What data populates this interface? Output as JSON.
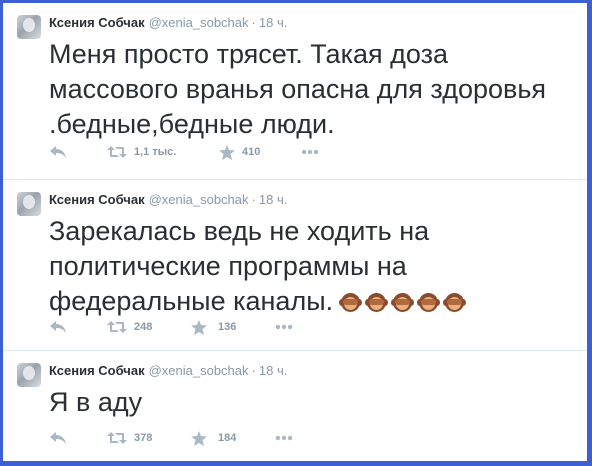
{
  "tweets": [
    {
      "name": "Ксения Собчак",
      "handle": "@xenia_sobchak",
      "separator": "·",
      "time": "18 ч.",
      "lines": [
        "Меня просто трясет. Такая доза",
        "массового вранья опасна для здоровья",
        ".бедные,бедные люди."
      ],
      "retweets": "1,1 тыс.",
      "favorites": "410"
    },
    {
      "name": "Ксения Собчак",
      "handle": "@xenia_sobchak",
      "separator": "·",
      "time": "18 ч.",
      "lines": [
        "Зарекалась ведь не ходить на",
        "политические программы на",
        "федеральные каналы."
      ],
      "emoji": "see-no-evil-monkey x5",
      "retweets": "248",
      "favorites": "136"
    },
    {
      "name": "Ксения Собчак",
      "handle": "@xenia_sobchak",
      "separator": "·",
      "time": "18 ч.",
      "lines": [
        "Я в аду"
      ],
      "retweets": "378",
      "favorites": "184"
    }
  ],
  "icons": {
    "reply": "reply-icon",
    "retweet": "retweet-icon",
    "favorite": "star-icon",
    "more": "more-icon"
  },
  "colors": {
    "frame_border": "#3d5fd6",
    "text": "#292f33",
    "muted": "#8899a6",
    "icon": "#aab8c2",
    "divider": "#e1e8ed"
  }
}
